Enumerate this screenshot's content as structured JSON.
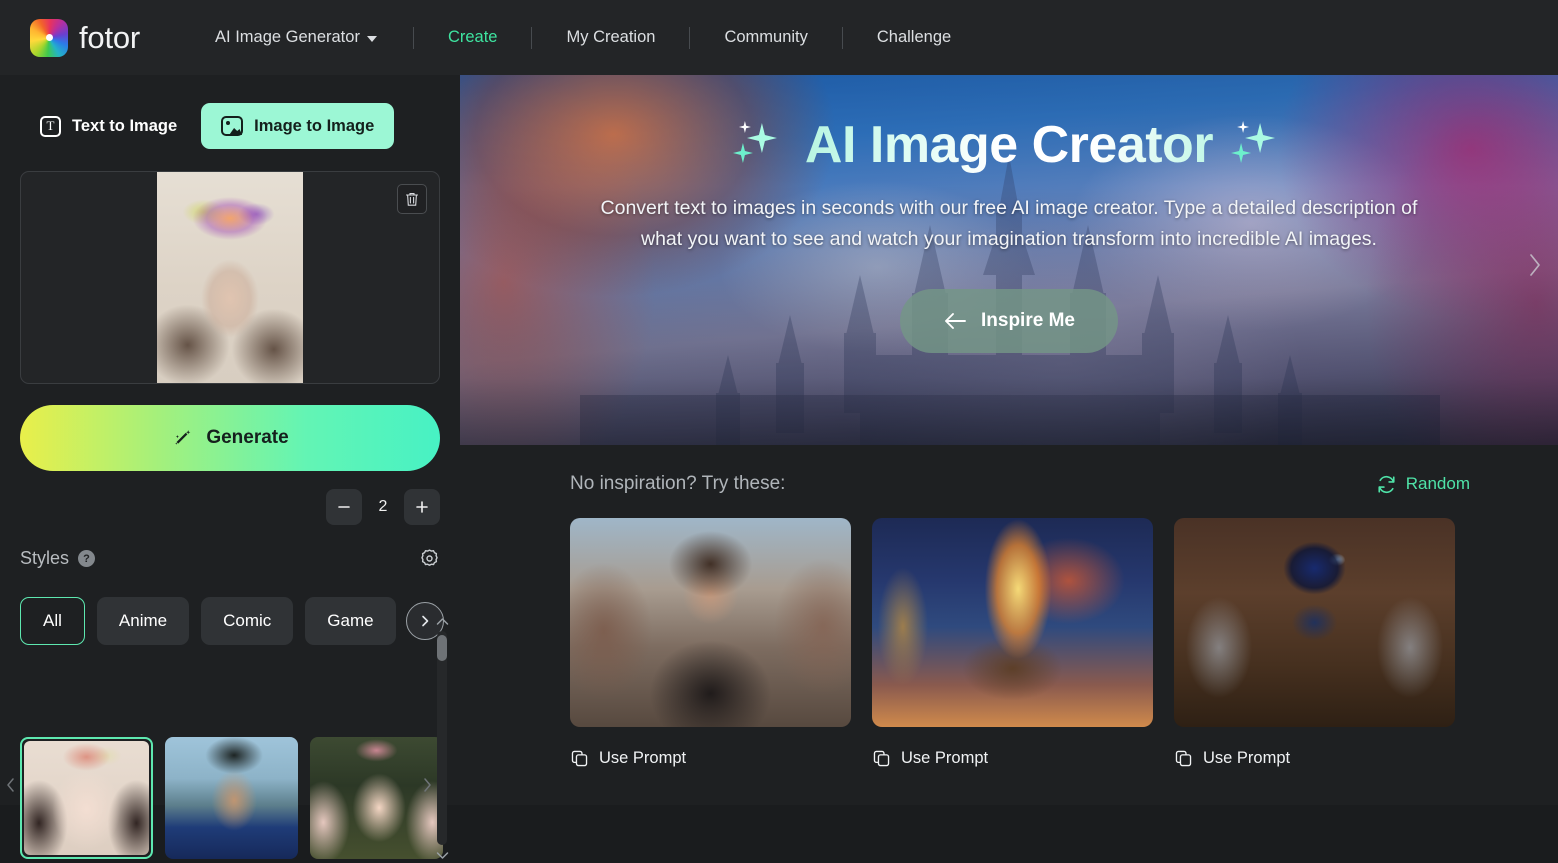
{
  "nav": {
    "brand": "fotor",
    "brand_icon": "fotor-color-wheel-logo",
    "items": [
      {
        "label": "AI Image Generator",
        "icon": "chevron-down-icon",
        "active": false
      },
      {
        "label": "Create",
        "active": true
      },
      {
        "label": "My Creation",
        "active": false
      },
      {
        "label": "Community",
        "active": false
      },
      {
        "label": "Challenge",
        "active": false
      }
    ]
  },
  "sidebar": {
    "modes": [
      {
        "label": "Text to Image",
        "icon": "text-t-icon",
        "active": false
      },
      {
        "label": "Image to Image",
        "icon": "picture-icon",
        "active": true
      }
    ],
    "upload": {
      "delete_icon": "trash-icon",
      "thumb_alt": "woman-with-flower-crown-photo"
    },
    "generate": {
      "label": "Generate",
      "icon": "magic-wand-icon"
    },
    "counter": {
      "value": "2",
      "decrement_label": "−",
      "increment_label": "+",
      "decrement_icon": "minus-icon",
      "increment_icon": "plus-icon"
    },
    "styles": {
      "label": "Styles",
      "help_icon": "question-mark-icon",
      "help_label": "?",
      "settings_icon": "gear-icon",
      "next_icon": "chevron-right-icon",
      "categories": [
        {
          "label": "All",
          "selected": true
        },
        {
          "label": "Anime",
          "selected": false
        },
        {
          "label": "Comic",
          "selected": false
        },
        {
          "label": "Game",
          "selected": false
        }
      ],
      "thumbs": [
        {
          "alt": "anime-girl-with-flowers-style",
          "selected": true
        },
        {
          "alt": "comic-man-city-style",
          "selected": false
        },
        {
          "alt": "pink-hair-girl-style",
          "selected": false
        }
      ],
      "scroll_up_icon": "chevron-up-icon",
      "scroll_down_icon": "chevron-down-icon",
      "scroll_left_icon": "chevron-left-icon",
      "scroll_right_icon": "chevron-right-icon"
    }
  },
  "hero": {
    "title": "AI Image Creator",
    "sparkle_icon": "sparkles-icon",
    "description": "Convert text to images in seconds with our free AI image creator. Type a detailed description of what you want to see and watch your imagination transform into incredible AI images.",
    "cta": {
      "label": "Inspire Me",
      "icon": "arrow-left-icon"
    },
    "next_icon": "chevron-right-icon",
    "background_alt": "fantasy-castle-autumn-trees-banner"
  },
  "inspiration": {
    "title": "No inspiration? Try these:",
    "random": {
      "label": "Random",
      "icon": "refresh-icon"
    },
    "cards": [
      {
        "alt": "tattooed-man-on-street-photo",
        "action_label": "Use Prompt",
        "action_icon": "copy-icon"
      },
      {
        "alt": "olympic-flame-eiffel-tower-painting",
        "action_label": "Use Prompt",
        "action_icon": "copy-icon"
      },
      {
        "alt": "blue-glass-spider-macro-photo",
        "action_label": "Use Prompt",
        "action_icon": "copy-icon"
      }
    ]
  },
  "colors": {
    "accent_green": "#3ee4a0",
    "mint_button": "#9cf7d5",
    "generate_gradient_start": "#e9ef4a",
    "generate_gradient_end": "#47f2c4",
    "panel_bg": "#1e2022",
    "nav_bg": "#232527"
  }
}
